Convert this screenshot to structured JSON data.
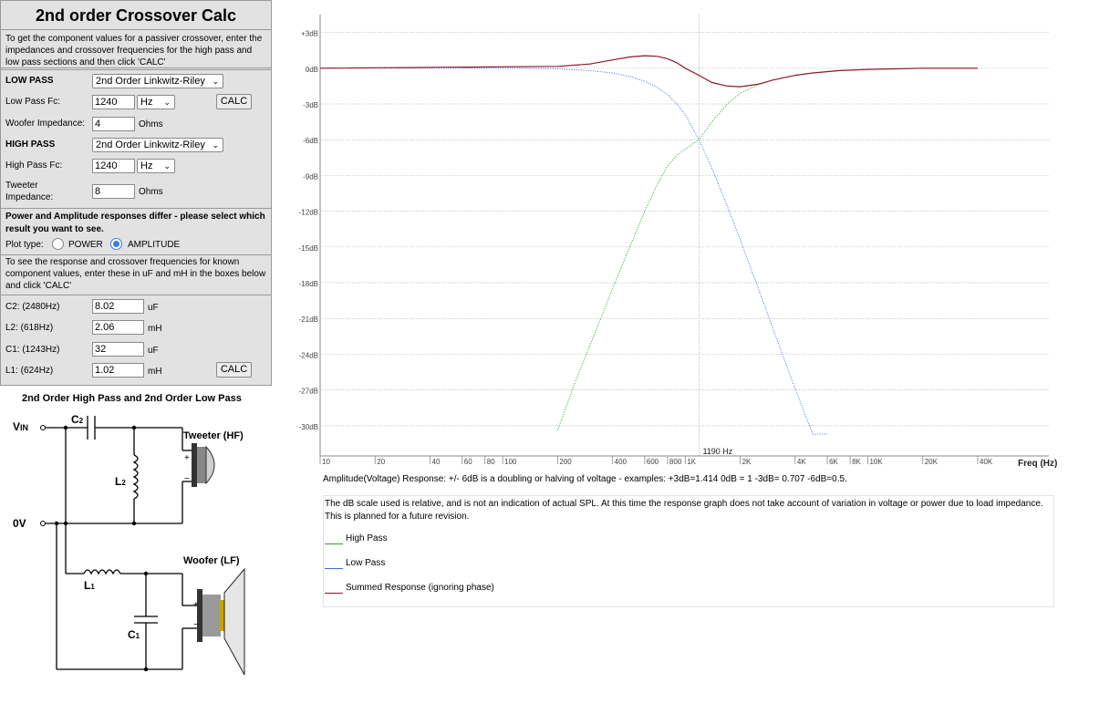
{
  "panel": {
    "title": "2nd order Crossover Calc",
    "intro": "To get the component values for a passiver crossover, enter the impedances and crossover frequencies for the high pass and low pass sections and then click 'CALC'",
    "low_pass_label": "LOW PASS",
    "low_pass_type": "2nd Order Linkwitz-Riley",
    "low_pass_fc_label": "Low Pass Fc:",
    "low_pass_fc_value": "1240",
    "low_pass_fc_unit": "Hz",
    "calc_label": "CALC",
    "woofer_imp_label": "Woofer Impedance:",
    "woofer_imp_value": "4",
    "ohms": "Ohms",
    "high_pass_label": "HIGH PASS",
    "high_pass_type": "2nd Order Linkwitz-Riley",
    "high_pass_fc_label": "High Pass Fc:",
    "high_pass_fc_value": "1240",
    "high_pass_fc_unit": "Hz",
    "tweeter_imp_label_1": "Tweeter",
    "tweeter_imp_label_2": "Impedance:",
    "tweeter_imp_value": "8",
    "power_note": "Power and Amplitude responses differ - please select which result you want to see.",
    "plot_type_label": "Plot type:",
    "power_label": "POWER",
    "amplitude_label": "AMPLITUDE",
    "selected_plot_type": "AMPLITUDE",
    "known_note": "To see the response and crossover frequencies for known component values, enter these in uF and mH in the boxes below and click 'CALC'",
    "components": [
      {
        "label": "C2: (2480Hz)",
        "value": "8.02",
        "unit": "uF"
      },
      {
        "label": "L2: (618Hz)",
        "value": "2.06",
        "unit": "mH"
      },
      {
        "label": "C1: (1243Hz)",
        "value": "32",
        "unit": "uF"
      },
      {
        "label": "L1: (624Hz)",
        "value": "1.02",
        "unit": "mH"
      }
    ]
  },
  "schematic": {
    "title": "2nd Order High Pass and 2nd Order Low Pass",
    "vin": "VIN",
    "vin_main": "V",
    "vin_sub": "IN",
    "ov": "0V",
    "c2": "C",
    "c2_sub": "2",
    "l2": "L",
    "l2_sub": "2",
    "l1": "L",
    "l1_sub": "1",
    "c1": "C",
    "c1_sub": "1",
    "tweeter": "Tweeter (HF)",
    "woofer": "Woofer (LF)",
    "plus": "+",
    "minus": "−"
  },
  "chart_data": {
    "type": "line",
    "x_scale": "log",
    "xlim": [
      10,
      40000
    ],
    "ylim": [
      -31.5,
      4.5
    ],
    "xlabel": "Freq (Hz)",
    "y_ticks": [
      "+3dB",
      "0dB",
      "-3dB",
      "-6dB",
      "-9dB",
      "-12dB",
      "-15dB",
      "-18dB",
      "-21dB",
      "-24dB",
      "-27dB",
      "-30dB"
    ],
    "y_tick_values": [
      3,
      0,
      -3,
      -6,
      -9,
      -12,
      -15,
      -18,
      -21,
      -24,
      -27,
      -30
    ],
    "x_ticks": [
      "10",
      "20",
      "40",
      "60",
      "80",
      "100",
      "200",
      "400",
      "600",
      "800",
      "1K",
      "2K",
      "4K",
      "6K",
      "8K",
      "10K",
      "20K",
      "40K"
    ],
    "x_tick_values": [
      10,
      20,
      40,
      60,
      80,
      100,
      200,
      400,
      600,
      800,
      1000,
      2000,
      4000,
      6000,
      8000,
      10000,
      20000,
      40000
    ],
    "crossover_marker_hz": 1190,
    "crossover_label": "1190 Hz",
    "grid": true,
    "series": [
      {
        "name": "High Pass",
        "color": "#2e9e2e",
        "x": [
          200,
          250,
          300,
          400,
          500,
          600,
          700,
          800,
          900,
          1000,
          1190,
          1400,
          1700,
          2000,
          2500,
          3000,
          4000,
          5000,
          7000,
          10000,
          15000,
          20000,
          30000,
          40000
        ],
        "y": [
          -30.4,
          -26.3,
          -23.3,
          -18.5,
          -14.9,
          -12.0,
          -9.8,
          -8.2,
          -7.3,
          -6.8,
          -6.0,
          -4.5,
          -3.0,
          -2.1,
          -1.4,
          -1.0,
          -0.6,
          -0.4,
          -0.2,
          -0.1,
          -0.05,
          0,
          0,
          0
        ]
      },
      {
        "name": "Low Pass",
        "color": "#3a6fd6",
        "x": [
          10,
          100,
          200,
          300,
          400,
          500,
          600,
          700,
          800,
          900,
          1000,
          1190,
          1400,
          1700,
          2000,
          2500,
          3000,
          4000,
          5000,
          6000
        ],
        "y": [
          0,
          0,
          -0.05,
          -0.2,
          -0.4,
          -0.7,
          -1.1,
          -1.6,
          -2.2,
          -3.0,
          -3.9,
          -6.0,
          -8.4,
          -11.6,
          -14.4,
          -18.4,
          -21.7,
          -26.9,
          -30.7,
          -30.7
        ]
      },
      {
        "name": "Summed Response (ignoring phase)",
        "color": "#8b1a2b",
        "x": [
          10,
          200,
          300,
          400,
          500,
          600,
          700,
          800,
          900,
          1000,
          1190,
          1400,
          1700,
          2000,
          2500,
          3000,
          4000,
          5000,
          7000,
          10000,
          20000,
          40000
        ],
        "y": [
          0,
          0.15,
          0.35,
          0.7,
          0.95,
          1.05,
          1.0,
          0.8,
          0.45,
          0.0,
          -0.6,
          -1.2,
          -1.5,
          -1.55,
          -1.35,
          -1.0,
          -0.6,
          -0.4,
          -0.2,
          -0.1,
          0,
          0
        ]
      }
    ]
  },
  "info": {
    "amplitude_note": "Amplitude(Voltage) Response: +/- 6dB is a doubling or halving of voltage - examples: +3dB=1.414  0dB = 1  -3dB= 0.707  -6dB=0.5.",
    "scale_note": "The dB scale used is relative, and is not an indication of actual SPL. At this time the response graph does not take account of variation in voltage or power due to load impedance. This is planned for a future revision."
  },
  "legend": [
    {
      "label": "High Pass",
      "color": "#2e9e2e"
    },
    {
      "label": "Low Pass",
      "color": "#3a6fd6"
    },
    {
      "label": "Summed Response (ignoring phase)",
      "color": "#8b1a2b"
    }
  ]
}
